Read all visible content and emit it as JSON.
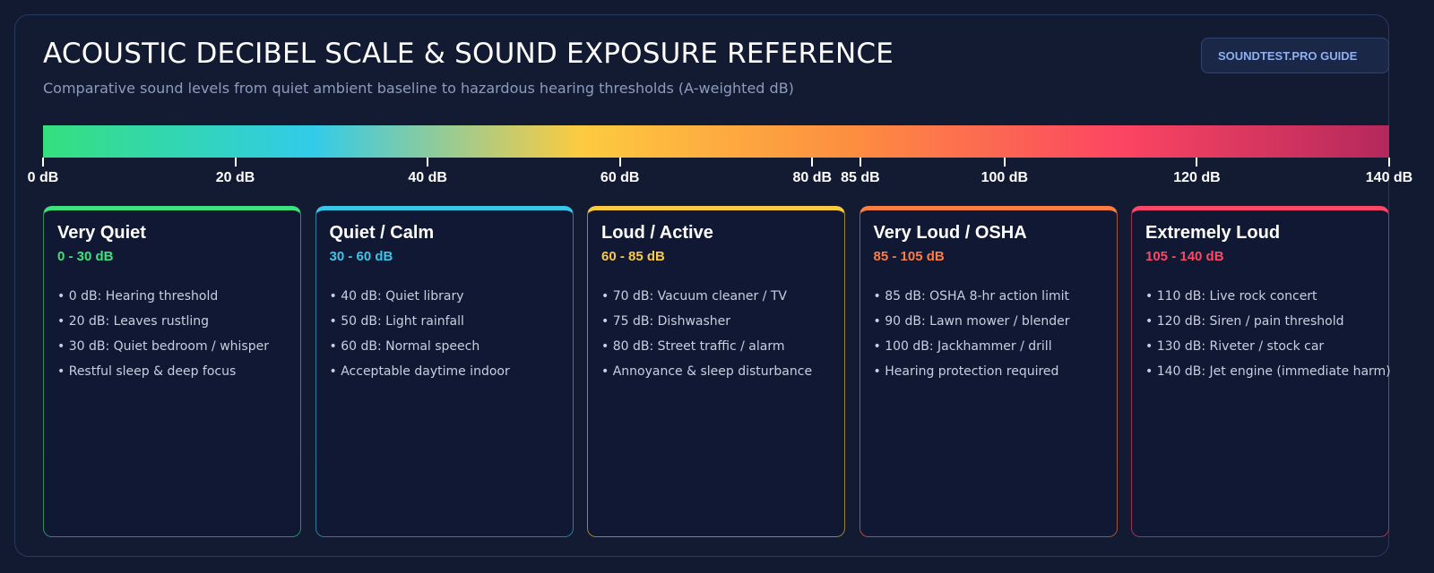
{
  "header": {
    "title": "ACOUSTIC DECIBEL SCALE & SOUND EXPOSURE REFERENCE",
    "subtitle": "Comparative sound levels from quiet ambient baseline to hazardous hearing thresholds (A-weighted dB)",
    "badge": "SOUNDTEST.PRO GUIDE"
  },
  "scale": {
    "max_db": 140,
    "gradient_colors": [
      "#34e07e",
      "#32cbe9",
      "#fdcb3f",
      "#fd8e40",
      "#fc4562",
      "#b4285c"
    ],
    "ticks": [
      {
        "value": 0,
        "label": "0 dB"
      },
      {
        "value": 20,
        "label": "20 dB"
      },
      {
        "value": 40,
        "label": "40 dB"
      },
      {
        "value": 60,
        "label": "60 dB"
      },
      {
        "value": 80,
        "label": "80 dB"
      },
      {
        "value": 85,
        "label": "85 dB"
      },
      {
        "value": 100,
        "label": "100 dB"
      },
      {
        "value": 120,
        "label": "120 dB"
      },
      {
        "value": 140,
        "label": "140 dB"
      }
    ]
  },
  "categories": [
    {
      "title": "Very Quiet",
      "range": "0 - 30 dB",
      "color": "#3de27f",
      "items": [
        "0 dB: Hearing threshold",
        "20 dB: Leaves rustling",
        "30 dB: Quiet bedroom / whisper",
        "Restful sleep & deep focus"
      ]
    },
    {
      "title": "Quiet / Calm",
      "range": "30 - 60 dB",
      "color": "#39c6e8",
      "items": [
        "40 dB: Quiet library",
        "50 dB: Light rainfall",
        "60 dB: Normal speech",
        "Acceptable daytime indoor"
      ]
    },
    {
      "title": "Loud / Active",
      "range": "60 - 85 dB",
      "color": "#fcc943",
      "items": [
        "70 dB: Vacuum cleaner / TV",
        "75 dB: Dishwasher",
        "80 dB: Street traffic / alarm",
        "Annoyance & sleep disturbance"
      ]
    },
    {
      "title": "Very Loud / OSHA",
      "range": "85 - 105 dB",
      "color": "#fd7d42",
      "items": [
        "85 dB: OSHA 8-hr action limit",
        "90 dB: Lawn mower / blender",
        "100 dB: Jackhammer / drill",
        "Hearing protection required"
      ]
    },
    {
      "title": "Extremely Loud",
      "range": "105 - 140 dB",
      "color": "#fc4866",
      "items": [
        "110 dB: Live rock concert",
        "120 dB: Siren / pain threshold",
        "130 dB: Riveter / stock car",
        "140 dB: Jet engine (immediate harm)"
      ]
    }
  ]
}
